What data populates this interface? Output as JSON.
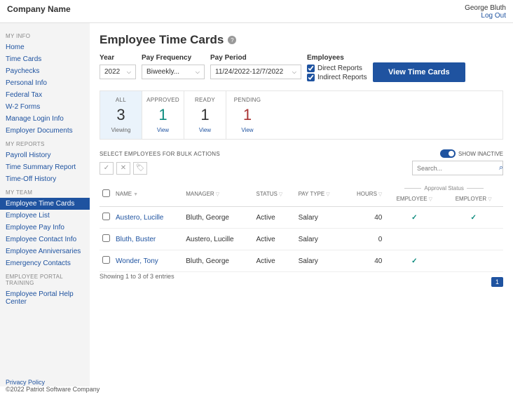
{
  "header": {
    "company": "Company Name",
    "user": "George Bluth",
    "logout": "Log Out"
  },
  "sidebar": {
    "sections": [
      {
        "title": "MY INFO",
        "items": [
          "Home",
          "Time Cards",
          "Paychecks",
          "Personal Info",
          "Federal Tax",
          "W-2 Forms",
          "Manage Login Info",
          "Employer Documents"
        ]
      },
      {
        "title": "MY REPORTS",
        "items": [
          "Payroll History",
          "Time Summary Report",
          "Time-Off History"
        ]
      },
      {
        "title": "MY TEAM",
        "items": [
          "Employee Time Cards",
          "Employee List",
          "Employee Pay Info",
          "Employee Contact Info",
          "Employee Anniversaries",
          "Emergency Contacts"
        ]
      },
      {
        "title": "EMPLOYEE PORTAL TRAINING",
        "items": [
          "Employee Portal Help Center"
        ]
      }
    ],
    "active": "Employee Time Cards"
  },
  "page": {
    "title": "Employee Time Cards"
  },
  "filters": {
    "year_label": "Year",
    "year_value": "2022",
    "freq_label": "Pay Frequency",
    "freq_value": "Biweekly...",
    "period_label": "Pay Period",
    "period_value": "11/24/2022-12/7/2022",
    "employees_label": "Employees",
    "direct_label": "Direct Reports",
    "indirect_label": "Indirect Reports",
    "view_btn": "View Time Cards"
  },
  "status": [
    {
      "label": "ALL",
      "count": "3",
      "link": "Viewing",
      "cls": "active",
      "countcls": ""
    },
    {
      "label": "APPROVED",
      "count": "1",
      "link": "View",
      "cls": "",
      "countcls": "teal"
    },
    {
      "label": "READY",
      "count": "1",
      "link": "View",
      "cls": "",
      "countcls": ""
    },
    {
      "label": "PENDING",
      "count": "1",
      "link": "View",
      "cls": "",
      "countcls": "red"
    }
  ],
  "bulk": {
    "label": "SELECT EMPLOYEES FOR BULK ACTIONS",
    "show_inactive": "SHOW INACTIVE",
    "search_placeholder": "Search..."
  },
  "table": {
    "headers": {
      "name": "NAME",
      "manager": "MANAGER",
      "status": "STATUS",
      "paytype": "PAY TYPE",
      "hours": "HOURS",
      "approval": "Approval Status",
      "employee": "EMPLOYEE",
      "employer": "EMPLOYER"
    },
    "rows": [
      {
        "name": "Austero, Lucille",
        "manager": "Bluth, George",
        "status": "Active",
        "paytype": "Salary",
        "hours": "40",
        "emp": "✓",
        "er": "✓"
      },
      {
        "name": "Bluth, Buster",
        "manager": "Austero, Lucille",
        "status": "Active",
        "paytype": "Salary",
        "hours": "0",
        "emp": "",
        "er": ""
      },
      {
        "name": "Wonder, Tony",
        "manager": "Bluth, George",
        "status": "Active",
        "paytype": "Salary",
        "hours": "40",
        "emp": "✓",
        "er": ""
      }
    ],
    "entries": "Showing 1 to 3 of 3 entries",
    "page": "1"
  },
  "footer": {
    "privacy": "Privacy Policy",
    "copyright": "©2022 Patriot Software Company"
  }
}
